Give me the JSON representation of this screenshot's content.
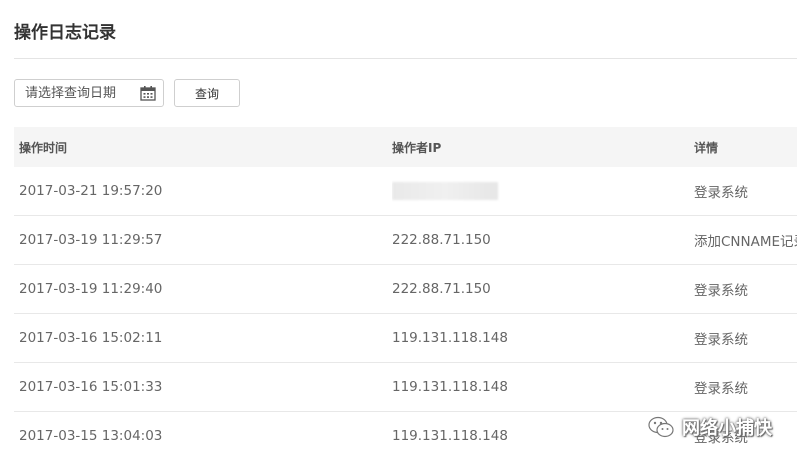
{
  "page": {
    "title": "操作日志记录"
  },
  "filter": {
    "date_placeholder": "请选择查询日期",
    "query_label": "查询",
    "calendar_icon": "calendar-icon"
  },
  "table": {
    "headers": {
      "time": "操作时间",
      "ip": "操作者IP",
      "detail": "详情"
    },
    "rows": [
      {
        "time": "2017-03-21 19:57:20",
        "ip": "",
        "ip_redacted": true,
        "detail": "登录系统"
      },
      {
        "time": "2017-03-19 11:29:57",
        "ip": "222.88.71.150",
        "detail": "添加CNNAME记录"
      },
      {
        "time": "2017-03-19 11:29:40",
        "ip": "222.88.71.150",
        "detail": "登录系统"
      },
      {
        "time": "2017-03-16 15:02:11",
        "ip": "119.131.118.148",
        "detail": "登录系统"
      },
      {
        "time": "2017-03-16 15:01:33",
        "ip": "119.131.118.148",
        "detail": "登录系统"
      },
      {
        "time": "2017-03-15 13:04:03",
        "ip": "119.131.118.148",
        "detail": "登录系统"
      }
    ]
  },
  "watermark": {
    "text": "网络小捕快",
    "icon": "wechat-icon"
  },
  "colors": {
    "header_bg": "#f5f5f5",
    "text": "#666666",
    "border": "#e8e8e8"
  }
}
